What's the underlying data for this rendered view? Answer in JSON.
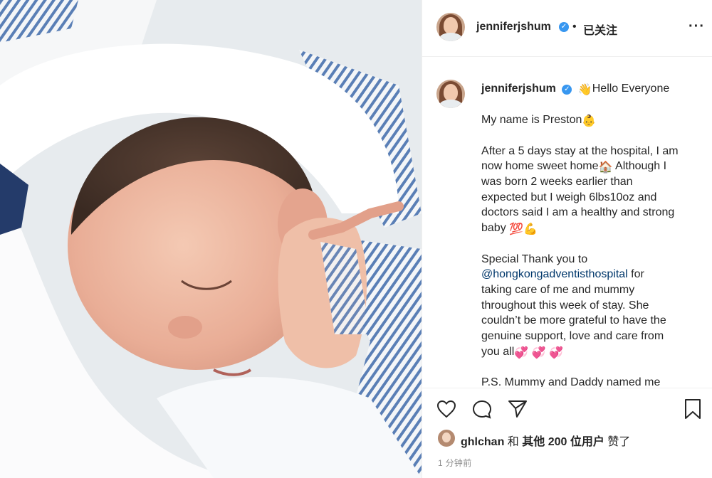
{
  "post": {
    "image": {
      "alt": ""
    }
  },
  "header": {
    "username": "jenniferjshum",
    "dot": "•",
    "follow_label": "已关注",
    "more_icon": "more-horizontal-icon"
  },
  "caption": {
    "username": "jenniferjshum",
    "lines": [
      "Hello Everyone",
      "My name is Preston",
      "After a 5 days stay at the hospital, I am",
      "now home sweet home",
      " Although I",
      "was born 2 weeks earlier than",
      "expected but I weigh 6lbs10oz and",
      "doctors said I am a healthy and strong",
      "baby",
      "Special Thank you to",
      "@hongkongadventisthospital",
      " for",
      "taking care of me and mummy",
      "throughout this week of stay. She",
      "couldn’t be more grateful to have the",
      "genuine support, love and care from",
      "you all",
      "P.S. Mummy and Daddy named me"
    ]
  },
  "actions": {
    "like_icon": "heart-icon",
    "comment_icon": "comment-icon",
    "share_icon": "paper-plane-icon",
    "save_icon": "bookmark-icon"
  },
  "likes": {
    "user": "ghlchan",
    "conjunction": " 和 ",
    "others": "其他 200 位用户",
    "suffix": " 赞了"
  },
  "timestamp": "1 分钟前",
  "colors": {
    "mention": "#00376b",
    "verified": "#3897f0",
    "text": "#262626",
    "muted": "#8e8e8e"
  }
}
